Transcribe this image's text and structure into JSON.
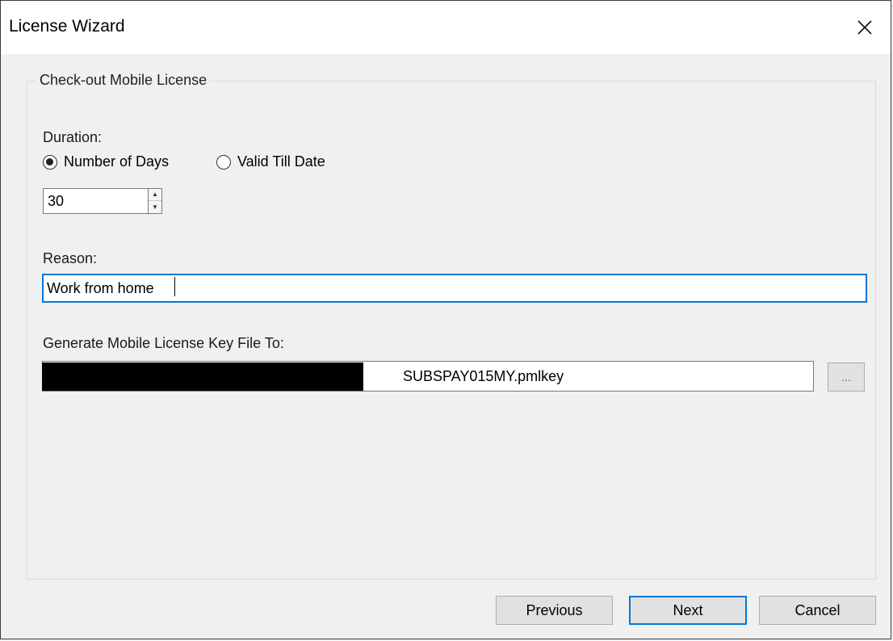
{
  "window": {
    "title": "License Wizard",
    "close_icon": "close-icon"
  },
  "group": {
    "title": "Check-out Mobile License"
  },
  "duration": {
    "label": "Duration:",
    "options": [
      {
        "label": "Number of Days",
        "checked": true
      },
      {
        "label": "Valid Till Date",
        "checked": false
      }
    ],
    "days_value": "30"
  },
  "reason": {
    "label": "Reason:",
    "value": "Work from home"
  },
  "keyfile": {
    "label": "Generate Mobile License Key File To:",
    "path_visible": "SUBSPAY015MY.pmlkey",
    "browse_label": "..."
  },
  "buttons": {
    "previous": "Previous",
    "next": "Next",
    "cancel": "Cancel"
  },
  "colors": {
    "focus_accent": "#0078d7"
  }
}
